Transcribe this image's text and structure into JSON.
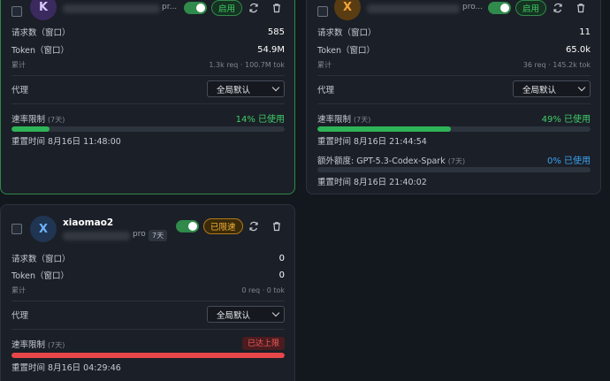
{
  "colors": {
    "accent_green": "#3fce68",
    "accent_blue": "#3aa3f2",
    "danger": "#f25c5c",
    "warn": "#f2b134"
  },
  "cards": [
    {
      "avatar_letter": "K",
      "plan": "pr...",
      "status_label": "启用",
      "metrics": [
        {
          "label": "请求数（窗口）",
          "value": "585"
        },
        {
          "label": "Token（窗口）",
          "value": "54.9M"
        }
      ],
      "cumulative_label": "累计",
      "cumulative_value": "1.3k req · 100.7M tok",
      "proxy_label": "代理",
      "proxy_value": "全局默认",
      "rate_label": "速率限制",
      "rate_period": "(7天)",
      "rate_status": "14% 已使用",
      "rate_progress": 0.14,
      "reset_label": "重置时间 8月16日 11:48:00"
    },
    {
      "avatar_letter": "X",
      "plan": "pro...",
      "status_label": "启用",
      "metrics": [
        {
          "label": "请求数（窗口）",
          "value": "11"
        },
        {
          "label": "Token（窗口）",
          "value": "65.0k"
        }
      ],
      "cumulative_label": "累计",
      "cumulative_value": "36 req · 145.2k tok",
      "proxy_label": "代理",
      "proxy_value": "全局默认",
      "rate_label": "速率限制",
      "rate_period": "(7天)",
      "rate_status": "49% 已使用",
      "rate_progress": 0.49,
      "reset_label": "重置时间 8月16日 21:44:54",
      "extra_label": "额外额度: GPT-5.3-Codex-Spark",
      "extra_period": "(7天)",
      "extra_status": "0% 已使用",
      "extra_progress": 0,
      "extra_reset_label": "重置时间 8月16日 21:40:02"
    },
    {
      "avatar_letter": "X",
      "name": "xiaomao2",
      "plan": "pro",
      "plan_tag": "7天",
      "status_label": "已限速",
      "metrics": [
        {
          "label": "请求数（窗口）",
          "value": "0"
        },
        {
          "label": "Token（窗口）",
          "value": "0"
        }
      ],
      "cumulative_label": "累计",
      "cumulative_value": "0 req · 0 tok",
      "proxy_label": "代理",
      "proxy_value": "全局默认",
      "rate_label": "速率限制",
      "rate_period": "(7天)",
      "rate_status": "已达上限",
      "rate_progress": 1,
      "reset_label": "重置时间 8月16日 04:29:46"
    }
  ]
}
